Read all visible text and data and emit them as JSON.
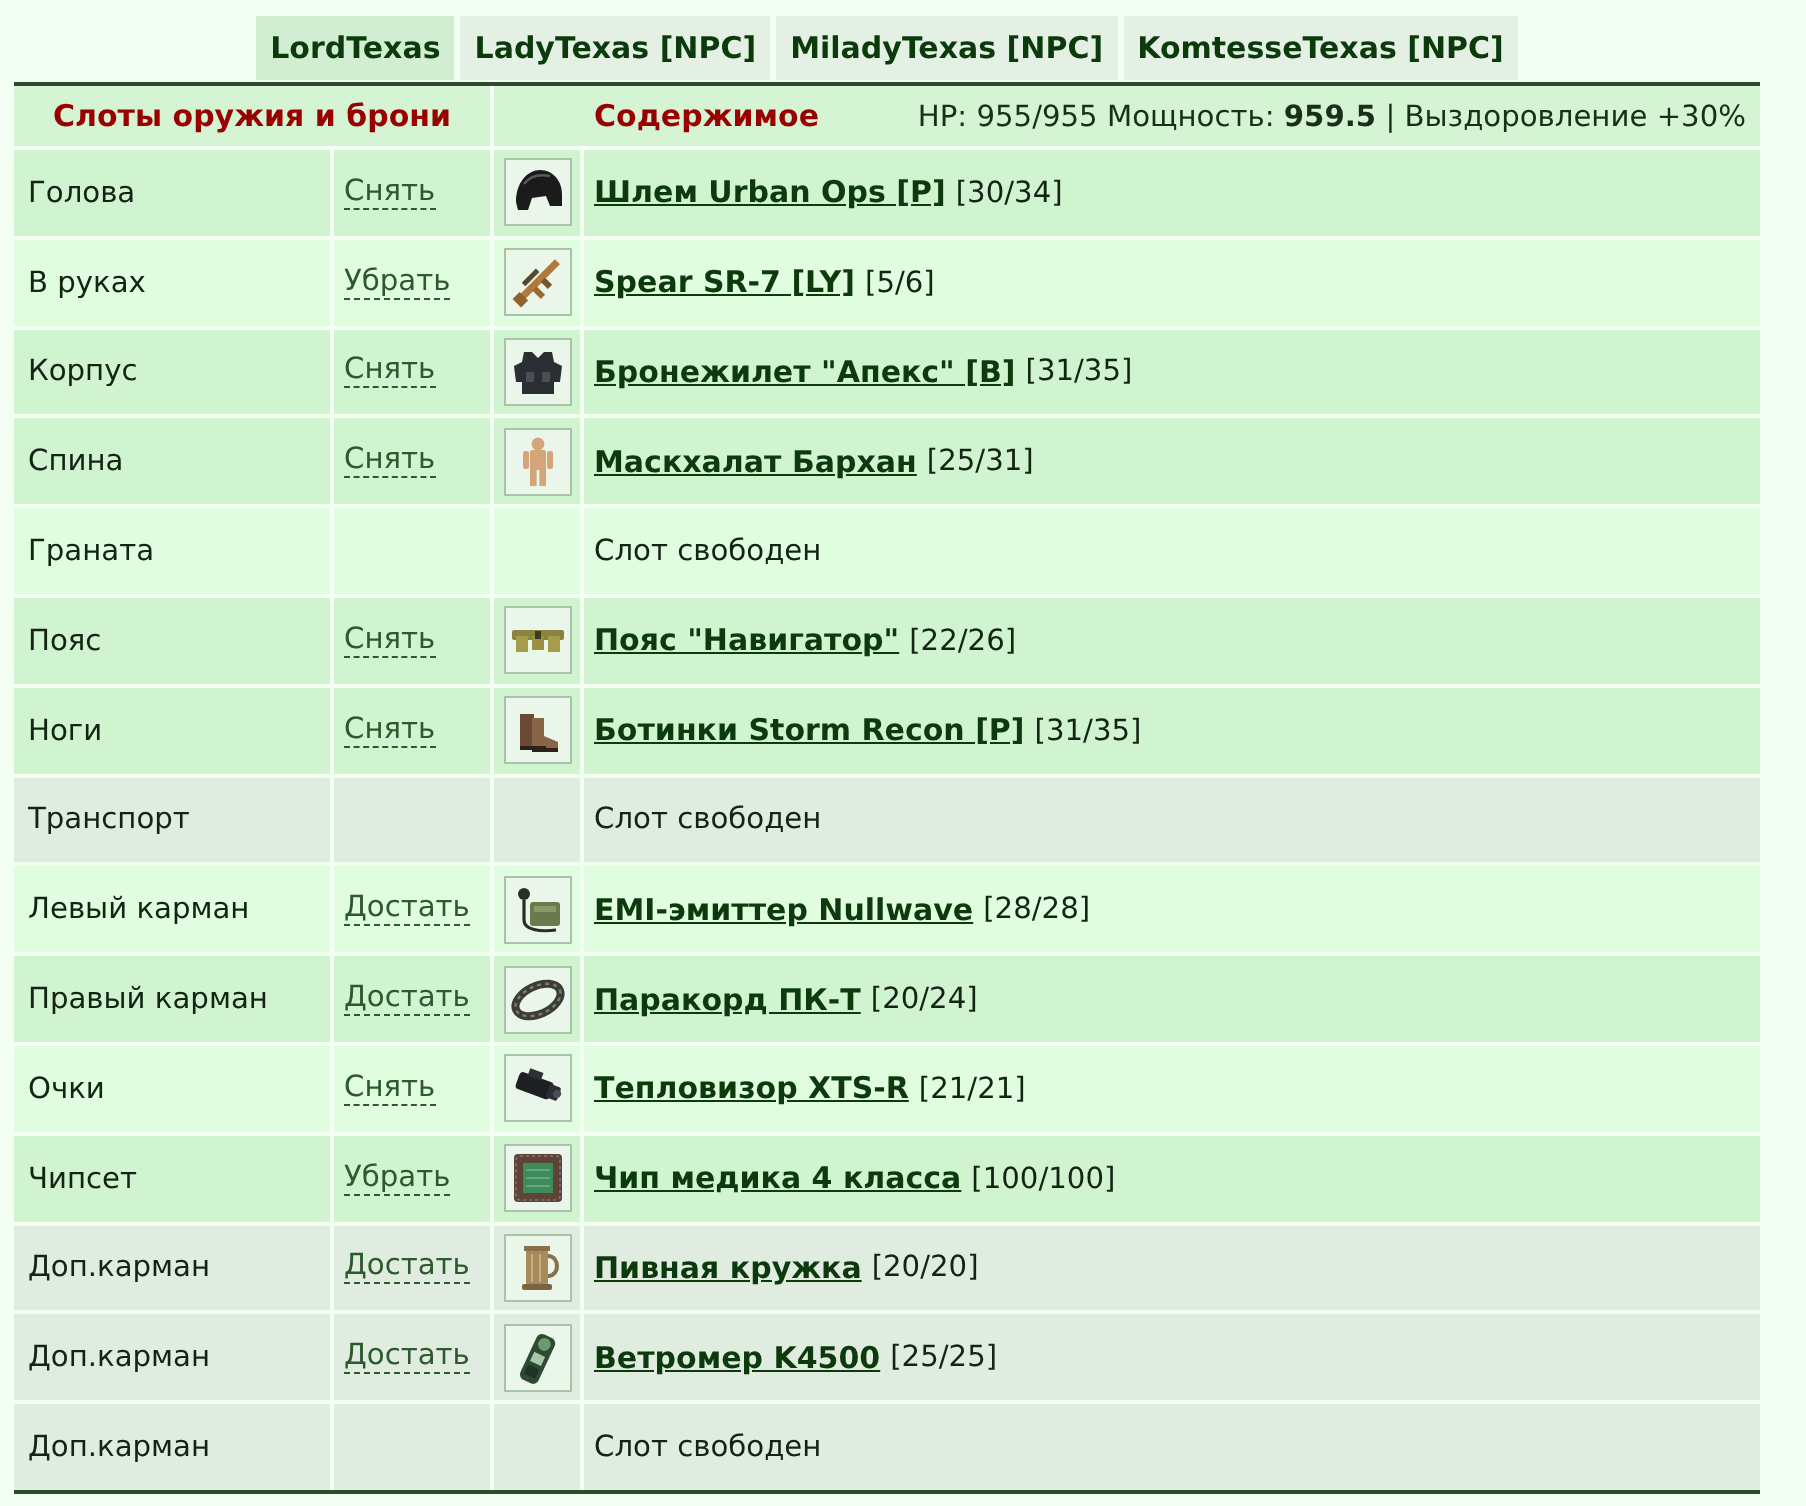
{
  "tabs": [
    {
      "label": "LordTexas",
      "selected": true
    },
    {
      "label": "LadyTexas [NPC]",
      "selected": false
    },
    {
      "label": "MiladyTexas [NPC]",
      "selected": false
    },
    {
      "label": "KomtesseTexas [NPC]",
      "selected": false
    }
  ],
  "header": {
    "slots_title": "Слоты оружия и брони",
    "contents_title": "Содержимое",
    "stats": "HP: 955/955 Мощность: **959.5** | Выздоровление +30%"
  },
  "slots": [
    {
      "slot": "Голова",
      "color": "#d0f3d0",
      "action": "Снять",
      "item": {
        "kind": "helmet",
        "name": "Шлем Urban Ops [P]",
        "durability": "[30/34]"
      }
    },
    {
      "slot": "В руках",
      "color": "#e0fde0",
      "action": "Убрать",
      "item": {
        "kind": "rifle",
        "name": "Spear SR-7 [LY]",
        "durability": "[5/6]"
      }
    },
    {
      "slot": "Корпус",
      "color": "#d0f3d0",
      "action": "Снять",
      "item": {
        "kind": "vest",
        "name": "Бронежилет \"Апекс\" [B]",
        "durability": "[31/35]"
      }
    },
    {
      "slot": "Спина",
      "color": "#d0f3d0",
      "action": "Снять",
      "item": {
        "kind": "suit",
        "name": "Маскхалат Бархан",
        "durability": "[25/31]"
      }
    },
    {
      "slot": "Граната",
      "color": "#e0fde0",
      "empty": "Слот свободен"
    },
    {
      "slot": "Пояс",
      "color": "#d0f3d0",
      "action": "Снять",
      "item": {
        "kind": "belt",
        "name": "Пояс \"Навигатор\"",
        "durability": "[22/26]"
      }
    },
    {
      "slot": "Ноги",
      "color": "#d0f3d0",
      "action": "Снять",
      "item": {
        "kind": "boots",
        "name": "Ботинки Storm Recon [P]",
        "durability": "[31/35]"
      }
    },
    {
      "slot": "Транспорт",
      "color": "#e0ece0",
      "empty": "Слот свободен"
    },
    {
      "slot": "Левый карман",
      "color": "#e0fde0",
      "action": "Достать",
      "item": {
        "kind": "radio",
        "name": "EMI-эмиттер Nullwave",
        "durability": "[28/28]"
      }
    },
    {
      "slot": "Правый карман",
      "color": "#d0f3d0",
      "action": "Достать",
      "item": {
        "kind": "bracelet",
        "name": "Паракорд ПК-Т",
        "durability": "[20/24]"
      }
    },
    {
      "slot": "Очки",
      "color": "#e0fde0",
      "action": "Снять",
      "item": {
        "kind": "imager",
        "name": "Тепловизор XTS-R",
        "durability": "[21/21]"
      }
    },
    {
      "slot": "Чипсет",
      "color": "#d0f3d0",
      "action": "Убрать",
      "item": {
        "kind": "chip",
        "name": "Чип медика 4 класса",
        "durability": "[100/100]"
      }
    },
    {
      "slot": "Доп.карман",
      "color": "#e0ece0",
      "action": "Достать",
      "item": {
        "kind": "mug",
        "name": "Пивная кружка",
        "durability": "[20/20]"
      }
    },
    {
      "slot": "Доп.карман",
      "color": "#e0ece0",
      "action": "Достать",
      "item": {
        "kind": "meter",
        "name": "Ветромер K4500",
        "durability": "[25/25]"
      }
    },
    {
      "slot": "Доп.карман",
      "color": "#e0ece0",
      "empty": "Слот свободен"
    }
  ]
}
